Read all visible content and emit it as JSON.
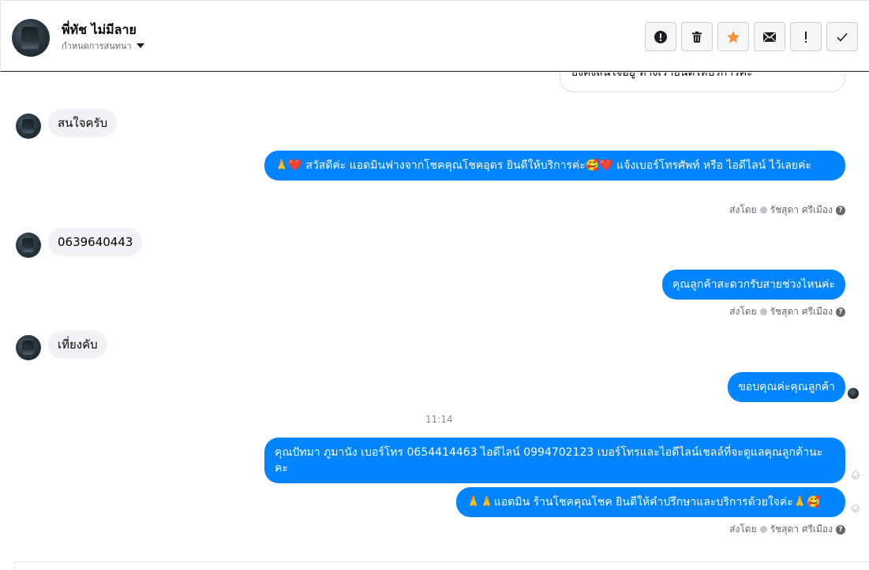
{
  "header": {
    "contact_name": "พี่ทัช ไม่มีลาย",
    "subtitle": "กำหนดการสนทนา",
    "toolbar_icons": [
      "alert-circle-icon",
      "trash-icon",
      "star-icon",
      "envelope-icon",
      "exclamation-icon",
      "check-icon"
    ],
    "star_color": "#f7923b"
  },
  "thread": {
    "cut_message_text": "ยังคงสนใจอยู่ ทางเรายินดีให้บริการค่ะ",
    "messages": [
      {
        "dir": "in",
        "text": "สนใจครับ"
      },
      {
        "dir": "out",
        "text": "🙏❤️ สวัสดีค่ะ แอดมินฟางจากโชคคุณโชคอุดร ยินดีให้บริการค่ะ🥰❤️ แจ้งเบอร์โทรศัพท์ หรือ ไอดีไลน์  ไว้เลยค่ะ"
      },
      {
        "dir": "in",
        "text": "0639640443"
      },
      {
        "dir": "out",
        "text": "คุณลูกค้าสะดวกรับสายช่วงไหนค่ะ"
      },
      {
        "dir": "in",
        "text": "เที่ยงคับ"
      },
      {
        "dir": "out",
        "text": "ขอบคุณค่ะคุณลูกค้า"
      },
      {
        "dir": "out",
        "text": "คุณปัทมา ภูมานัง    เบอร์โทร 0654414463  ไอดีไลน์ 0994702123   เบอร์โทรและไอดีไลน์เชลล์ที่จะดูแลคุณลูกค้านะคะ"
      },
      {
        "dir": "out",
        "text": "🙏🙏แอดมิน ร้านโชคคุณโชค ยินดีให้คำปรึกษาและบริการด้วยใจค่ะ🙏🥰"
      }
    ],
    "sent_by": {
      "prefix": "ส่งโดย",
      "agent": "รัชสุดา ศรีเมือง",
      "help": "?"
    },
    "time_separator": "11:14",
    "accent_color": "#0084ff"
  }
}
